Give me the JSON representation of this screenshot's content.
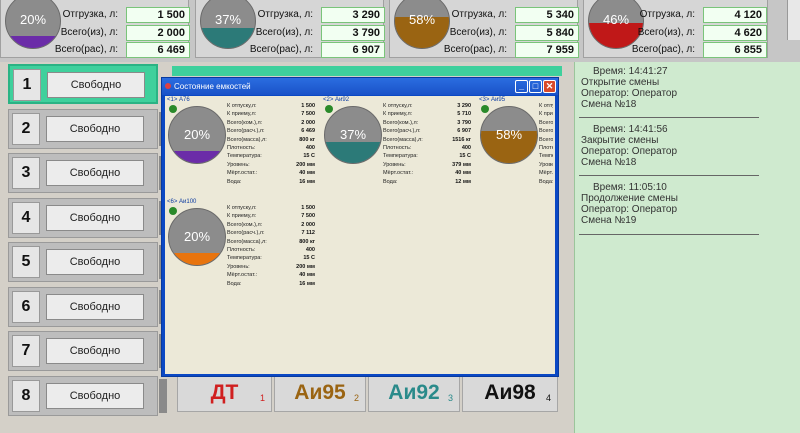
{
  "top_tanks": [
    {
      "pct": "20%",
      "level": 0.22,
      "fill_color": "#6b2ca8",
      "otgruzka_label": "Отгрузка, л:",
      "otgruzka": "1 500",
      "vsego_iz_label": "Всего(из), л:",
      "vsego_iz": "2 000",
      "vsego_ras_label": "Всего(рас), л:",
      "vsego_ras": "6 469"
    },
    {
      "pct": "37%",
      "level": 0.37,
      "fill_color": "#2c7a78",
      "otgruzka_label": "Отгрузка, л:",
      "otgruzka": "3 290",
      "vsego_iz_label": "Всего(из), л:",
      "vsego_iz": "3 790",
      "vsego_ras_label": "Всего(рас), л:",
      "vsego_ras": "6 907"
    },
    {
      "pct": "58%",
      "level": 0.58,
      "fill_color": "#9a6412",
      "otgruzka_label": "Отгрузка, л:",
      "otgruzka": "5 340",
      "vsego_iz_label": "Всего(из), л:",
      "vsego_iz": "5 840",
      "vsego_ras_label": "Всего(рас), л:",
      "vsego_ras": "7 959"
    },
    {
      "pct": "46%",
      "level": 0.46,
      "fill_color": "#c01818",
      "otgruzka_label": "Отгрузка, л:",
      "otgruzka": "4 120",
      "vsego_iz_label": "Всего(из), л:",
      "vsego_iz": "4 620",
      "vsego_ras_label": "Всего(рас), л:",
      "vsego_ras": "6 855"
    }
  ],
  "pumps": [
    {
      "num": "1",
      "status": "Свободно"
    },
    {
      "num": "2",
      "status": "Свободно"
    },
    {
      "num": "3",
      "status": "Свободно"
    },
    {
      "num": "4",
      "status": "Свободно"
    },
    {
      "num": "5",
      "status": "Свободно"
    },
    {
      "num": "6",
      "status": "Свободно"
    },
    {
      "num": "7",
      "status": "Свободно"
    },
    {
      "num": "8",
      "status": "Свободно"
    }
  ],
  "fuel_row": [
    {
      "name": "ДТ",
      "idx": "1",
      "color": "#d02020"
    },
    {
      "name": "Аи95",
      "idx": "2",
      "color": "#9a6412"
    },
    {
      "name": "Аи92",
      "idx": "3",
      "color": "#2a8a8a"
    },
    {
      "name": "Аи98",
      "idx": "4",
      "color": "#111111"
    }
  ],
  "log": [
    {
      "time": "Время: 14:41:27",
      "event": "Открытие смены",
      "operator": "Оператор: Оператор",
      "shift": "Смена №18"
    },
    {
      "time": "Время: 14:41:56",
      "event": "Закрытие смены",
      "operator": "Оператор: Оператор",
      "shift": "Смена №18"
    },
    {
      "time": "Время: 11:05:10",
      "event": "Продолжение смены",
      "operator": "Оператор: Оператор",
      "shift": "Смена №19"
    }
  ],
  "dialog": {
    "title": "Состояние емкостей",
    "minimize_glyph": "_",
    "maximize_glyph": "□",
    "close_glyph": "✕",
    "tanks": [
      {
        "header": "<1> А76",
        "pct": "20%",
        "level": 0.22,
        "fill_color": "#6b2ca8",
        "rows": [
          [
            "К отпуску,л:",
            "1 500"
          ],
          [
            "К приему,л:",
            "7 500"
          ],
          [
            "Всего(ком.),л:",
            "2 000"
          ],
          [
            "Всего(расч.),л:",
            "6 469"
          ],
          [
            "Всего(масса),л:",
            "800 кг"
          ],
          [
            "Плотность:",
            "400"
          ],
          [
            "Температура:",
            "15 С"
          ],
          [
            "Уровень:",
            "200 мм"
          ],
          [
            "Мёрт.остат.:",
            "40 мм"
          ],
          [
            "Вода:",
            "16 мм"
          ]
        ]
      },
      {
        "header": "<2> Аи92",
        "pct": "37%",
        "level": 0.37,
        "fill_color": "#2c7a78",
        "rows": [
          [
            "К отпуску,л:",
            "3 290"
          ],
          [
            "К приему,л:",
            "5 710"
          ],
          [
            "Всего(ком.),л:",
            "3 790"
          ],
          [
            "Всего(расч.),л:",
            "6 907"
          ],
          [
            "Всего(масса),л:",
            "1516 кг"
          ],
          [
            "Плотность:",
            "400"
          ],
          [
            "Температура:",
            "15 С"
          ],
          [
            "Уровень:",
            "379 мм"
          ],
          [
            "Мёрт.остат.:",
            "40 мм"
          ],
          [
            "Вода:",
            "12 мм"
          ]
        ]
      },
      {
        "header": "<3> Аи95",
        "pct": "58%",
        "level": 0.58,
        "fill_color": "#9a6412",
        "rows": [
          [
            "К отпуску,л:",
            ""
          ],
          [
            "К приему,л:",
            ""
          ],
          [
            "Всего(ком.),л:",
            ""
          ],
          [
            "Всего(расч.),л:",
            ""
          ],
          [
            "Всего(масса),л:",
            ""
          ],
          [
            "Плотность:",
            ""
          ],
          [
            "Температура:",
            ""
          ],
          [
            "Уровень:",
            ""
          ],
          [
            "Мёрт.остат.:",
            ""
          ],
          [
            "Вода:",
            ""
          ]
        ]
      },
      {
        "header": "<6> Аи100",
        "pct": "20%",
        "level": 0.22,
        "fill_color": "#e8740e",
        "rows": [
          [
            "К отпуску,л:",
            "1 500"
          ],
          [
            "К приему,л:",
            "7 500"
          ],
          [
            "Всего(ком.),л:",
            "2 000"
          ],
          [
            "Всего(расч.),л:",
            "7 112"
          ],
          [
            "Всего(масса),л:",
            "800 кг"
          ],
          [
            "Плотность:",
            "400"
          ],
          [
            "Температура:",
            "15 С"
          ],
          [
            "Уровень:",
            "200 мм"
          ],
          [
            "Мёрт.остат.:",
            "40 мм"
          ],
          [
            "Вода:",
            "16 мм"
          ]
        ]
      }
    ]
  }
}
